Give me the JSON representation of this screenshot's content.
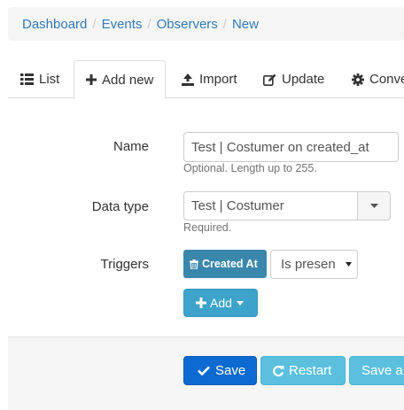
{
  "breadcrumb": [
    "Dashboard",
    "Events",
    "Observers",
    "New"
  ],
  "tabs": [
    {
      "label": "List",
      "icon": "list-icon",
      "active": false
    },
    {
      "label": "Add new",
      "icon": "plus-icon",
      "active": true
    },
    {
      "label": "Import",
      "icon": "import-icon",
      "active": false
    },
    {
      "label": "Update",
      "icon": "edit-icon",
      "active": false
    },
    {
      "label": "Conve",
      "icon": "cog-icon",
      "active": false
    }
  ],
  "form": {
    "name": {
      "label": "Name",
      "value": "Test | Costumer on created_at",
      "help": "Optional. Length up to 255."
    },
    "data_type": {
      "label": "Data type",
      "value": "Test | Costumer",
      "help": "Required."
    },
    "triggers": {
      "label": "Triggers",
      "chip": "Created At",
      "condition": "Is presen",
      "add": "Add"
    }
  },
  "footer": {
    "save": "Save",
    "restart": "Restart",
    "save_and": "Save a"
  },
  "colors": {
    "link": "#337ab7",
    "primary": "#0d6ad1",
    "info": "#46b8da",
    "info_dark": "#31b0d5",
    "chip": "#3a87ad"
  }
}
